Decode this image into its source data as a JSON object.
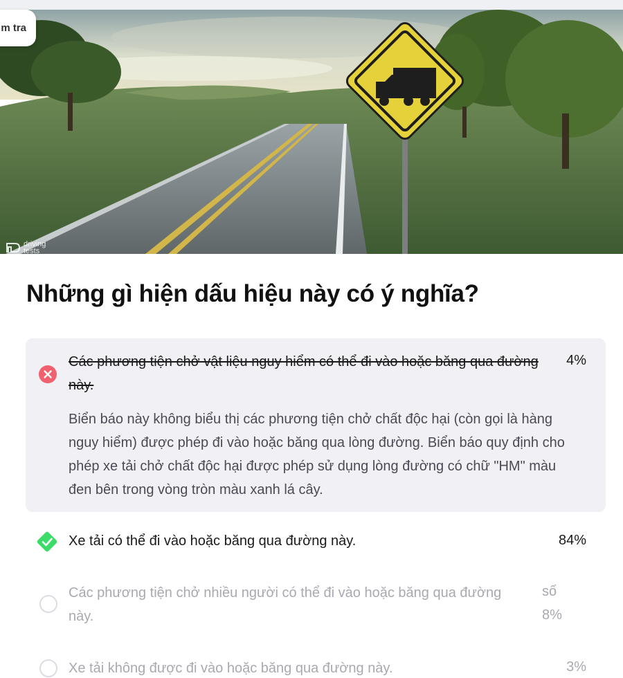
{
  "header": {
    "check_label": "m tra"
  },
  "hero": {
    "watermark": [
      "driving",
      "tests"
    ]
  },
  "question": "Những gì hiện dấu hiệu này có ý nghĩa?",
  "answers": [
    {
      "text": "Các phương tiện chở vật liệu nguy hiểm có thể đi vào hoặc băng qua đường này.",
      "percent": "4%",
      "status": "wrong",
      "explanation": "Biển báo này không biểu thị các phương tiện chở chất độc hại (còn gọi là hàng nguy hiểm) được phép đi vào hoặc băng qua lòng đường. Biển báo quy định cho phép xe tải chở chất độc hại được phép sử dụng lòng đường có chữ \"HM\" màu đen bên trong vòng tròn màu xanh lá cây."
    },
    {
      "text": "Xe tải có thể đi vào hoặc băng qua đường này.",
      "percent": "84%",
      "status": "correct"
    },
    {
      "text": "Các phương tiện chở nhiều người có thể đi vào hoặc băng qua đường này.",
      "percent_label": "số",
      "percent": "8%",
      "status": "unselected"
    },
    {
      "text": "Xe tải không được đi vào hoặc băng qua đường này.",
      "percent": "3%",
      "status": "unselected"
    }
  ],
  "colors": {
    "wrong": "#f0616d",
    "correct": "#3ddc6a",
    "muted_text": "#a9a9b0",
    "card_bg": "#f1f1f5"
  },
  "icons": [
    "close-icon",
    "check-icon",
    "radio-empty-icon",
    "truck-icon",
    "driving-tests-logo-icon"
  ]
}
